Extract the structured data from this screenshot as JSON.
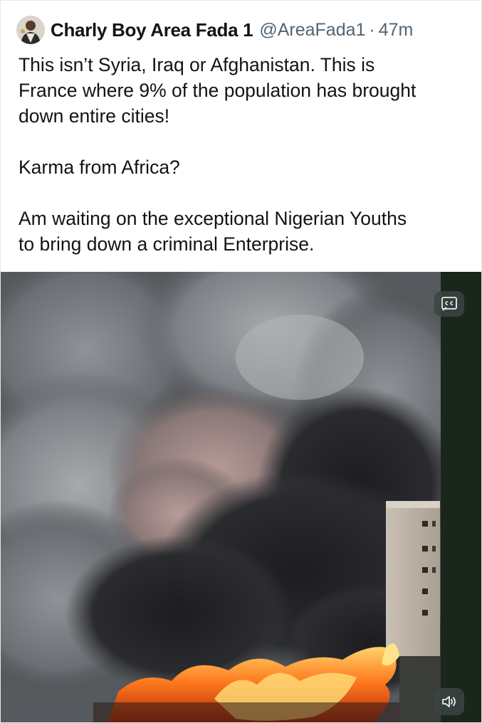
{
  "tweet": {
    "author": {
      "display_name": "Charly Boy Area Fada 1",
      "handle": "@AreaFada1",
      "separator": "·",
      "time": "47m"
    },
    "lines": [
      "This isn’t Syria, Iraq or Afghanistan. This is",
      "France where 9% of the population has brought",
      "down entire cities!",
      "Karma from Africa?",
      "Am waiting on the exceptional Nigerian Youths",
      "to bring down a criminal Enterprise."
    ]
  },
  "media": {
    "type": "video",
    "icons": {
      "captions": "closed-captions-icon",
      "volume": "volume-icon"
    },
    "colors": {
      "smoke": "#5f6266",
      "fire": "#ff6a1a",
      "side_strip": "#1a261c"
    }
  }
}
